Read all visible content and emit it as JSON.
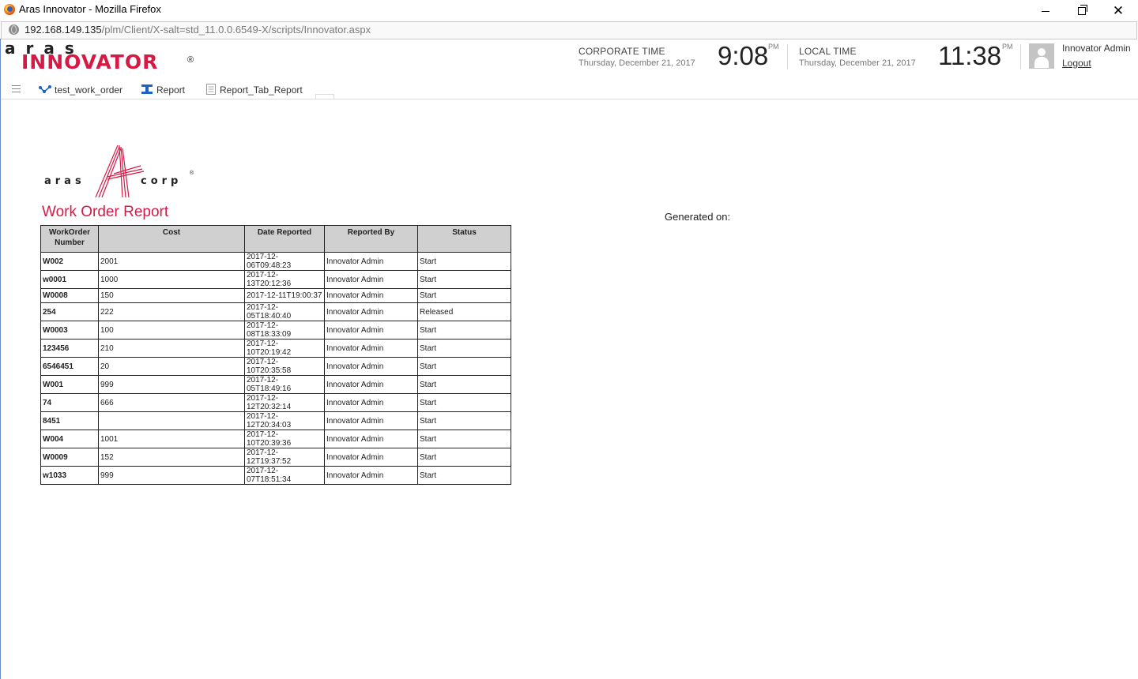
{
  "window": {
    "title": "Aras Innovator - Mozilla Firefox",
    "url_host": "192.168.149.135",
    "url_path": "/plm/Client/X-salt=std_11.0.0.6549-X/scripts/Innovator.aspx"
  },
  "header": {
    "logo_top": "aras",
    "logo_main": "INNOVATOR",
    "logo_reg": "®",
    "corporate": {
      "label": "CORPORATE TIME",
      "date": "Thursday, December 21, 2017",
      "time": "9:08",
      "ampm": "PM"
    },
    "local": {
      "label": "LOCAL TIME",
      "date": "Thursday, December 21, 2017",
      "time": "11:38",
      "ampm": "PM"
    },
    "user_name": "Innovator Admin",
    "logout_label": "Logout"
  },
  "tabs": [
    {
      "label": "test_work_order",
      "icon": "workflow-icon"
    },
    {
      "label": "Report",
      "icon": "report-icon"
    },
    {
      "label": "Report_Tab_Report",
      "icon": "document-icon"
    }
  ],
  "report": {
    "logo_left": "aras",
    "logo_right": "corp",
    "logo_reg": "®",
    "title": "Work Order Report",
    "generated_label": "Generated on:",
    "columns": [
      "WorkOrder Number",
      "Cost",
      "Date Reported",
      "Reported By",
      "Status"
    ],
    "rows": [
      [
        "W002",
        "2001",
        "2017-12-06T09:48:23",
        "Innovator Admin",
        "Start"
      ],
      [
        "w0001",
        "1000",
        "2017-12-13T20:12:36",
        "Innovator Admin",
        "Start"
      ],
      [
        "W0008",
        "150",
        "2017-12-11T19:00:37",
        "Innovator Admin",
        "Start"
      ],
      [
        "254",
        "222",
        "2017-12-05T18:40:40",
        "Innovator Admin",
        "Released"
      ],
      [
        "W0003",
        "100",
        "2017-12-08T18:33:09",
        "Innovator Admin",
        "Start"
      ],
      [
        "123456",
        "210",
        "2017-12-10T20:19:42",
        "Innovator Admin",
        "Start"
      ],
      [
        "6546451",
        "20",
        "2017-12-10T20:35:58",
        "Innovator Admin",
        "Start"
      ],
      [
        "W001",
        "999",
        "2017-12-05T18:49:16",
        "Innovator Admin",
        "Start"
      ],
      [
        "74",
        "666",
        "2017-12-12T20:32:14",
        "Innovator Admin",
        "Start"
      ],
      [
        "8451",
        "",
        "2017-12-12T20:34:03",
        "Innovator Admin",
        "Start"
      ],
      [
        "W004",
        "1001",
        "2017-12-10T20:39:36",
        "Innovator Admin",
        "Start"
      ],
      [
        "W0009",
        "152",
        "2017-12-12T19:37:52",
        "Innovator Admin",
        "Start"
      ],
      [
        "w1033",
        "999",
        "2017-12-07T18:51:34",
        "Innovator Admin",
        "Start"
      ]
    ]
  },
  "colors": {
    "brand_red": "#d61a46",
    "header_gray": "#d0d0d0",
    "tab_icon_blue": "#1a64c8"
  }
}
